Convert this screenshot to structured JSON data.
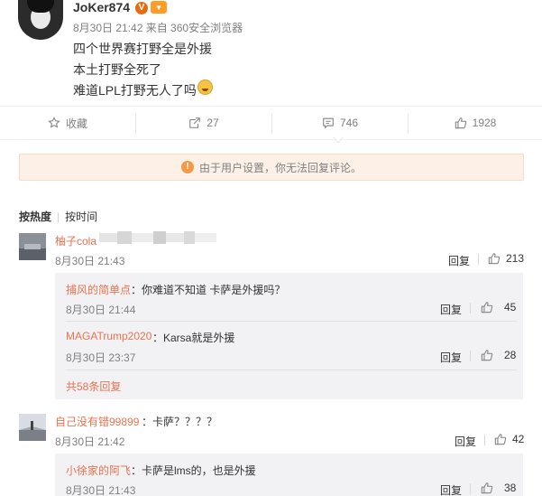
{
  "post": {
    "username": "JoKer874",
    "verified_badge": "V",
    "meta": "8月30日 21:42 来自 360安全浏览器",
    "lines": [
      "四个世界赛打野全是外援",
      "本土打野全死了",
      "难道LPL打野无人了吗"
    ],
    "emoji_icon": "laugh-cry-emoji"
  },
  "actions": {
    "favorite": "收藏",
    "repost_count": "27",
    "comment_count": "746",
    "like_count": "1928"
  },
  "notice": {
    "text": "由于用户设置，你无法回复评论。",
    "icon": "!"
  },
  "sort": {
    "hot": "按热度",
    "time": "按时间"
  },
  "comments": [
    {
      "name": "柚子cola",
      "text": "",
      "time": "8月30日 21:43",
      "reply_label": "回复",
      "likes": "213",
      "sub_replies": [
        {
          "name": "捕风的简单点",
          "text": "：你难道不知道   卡萨是外援吗？",
          "time": "8月30日 21:44",
          "reply_label": "回复",
          "likes": "45"
        },
        {
          "name": "MAGATrump2020",
          "text": "：Karsa就是外援",
          "time": "8月30日 23:37",
          "reply_label": "回复",
          "likes": "28"
        }
      ],
      "more_replies": "共58条回复"
    },
    {
      "name": "自己没有错99899",
      "text": "：卡萨？？？？",
      "time": "8月30日 21:42",
      "reply_label": "回复",
      "likes": "42",
      "sub_replies": [
        {
          "name": "小徐家的阿飞",
          "text": "：卡萨是lms的，也是外援",
          "time": "8月30日 21:43",
          "reply_label": "回复",
          "likes": "38"
        }
      ]
    }
  ],
  "colors": {
    "link": "#eb7350",
    "notice_bg": "#fdf0e6",
    "warn": "#f49a46",
    "subblock_bg": "#f2f2f5"
  }
}
